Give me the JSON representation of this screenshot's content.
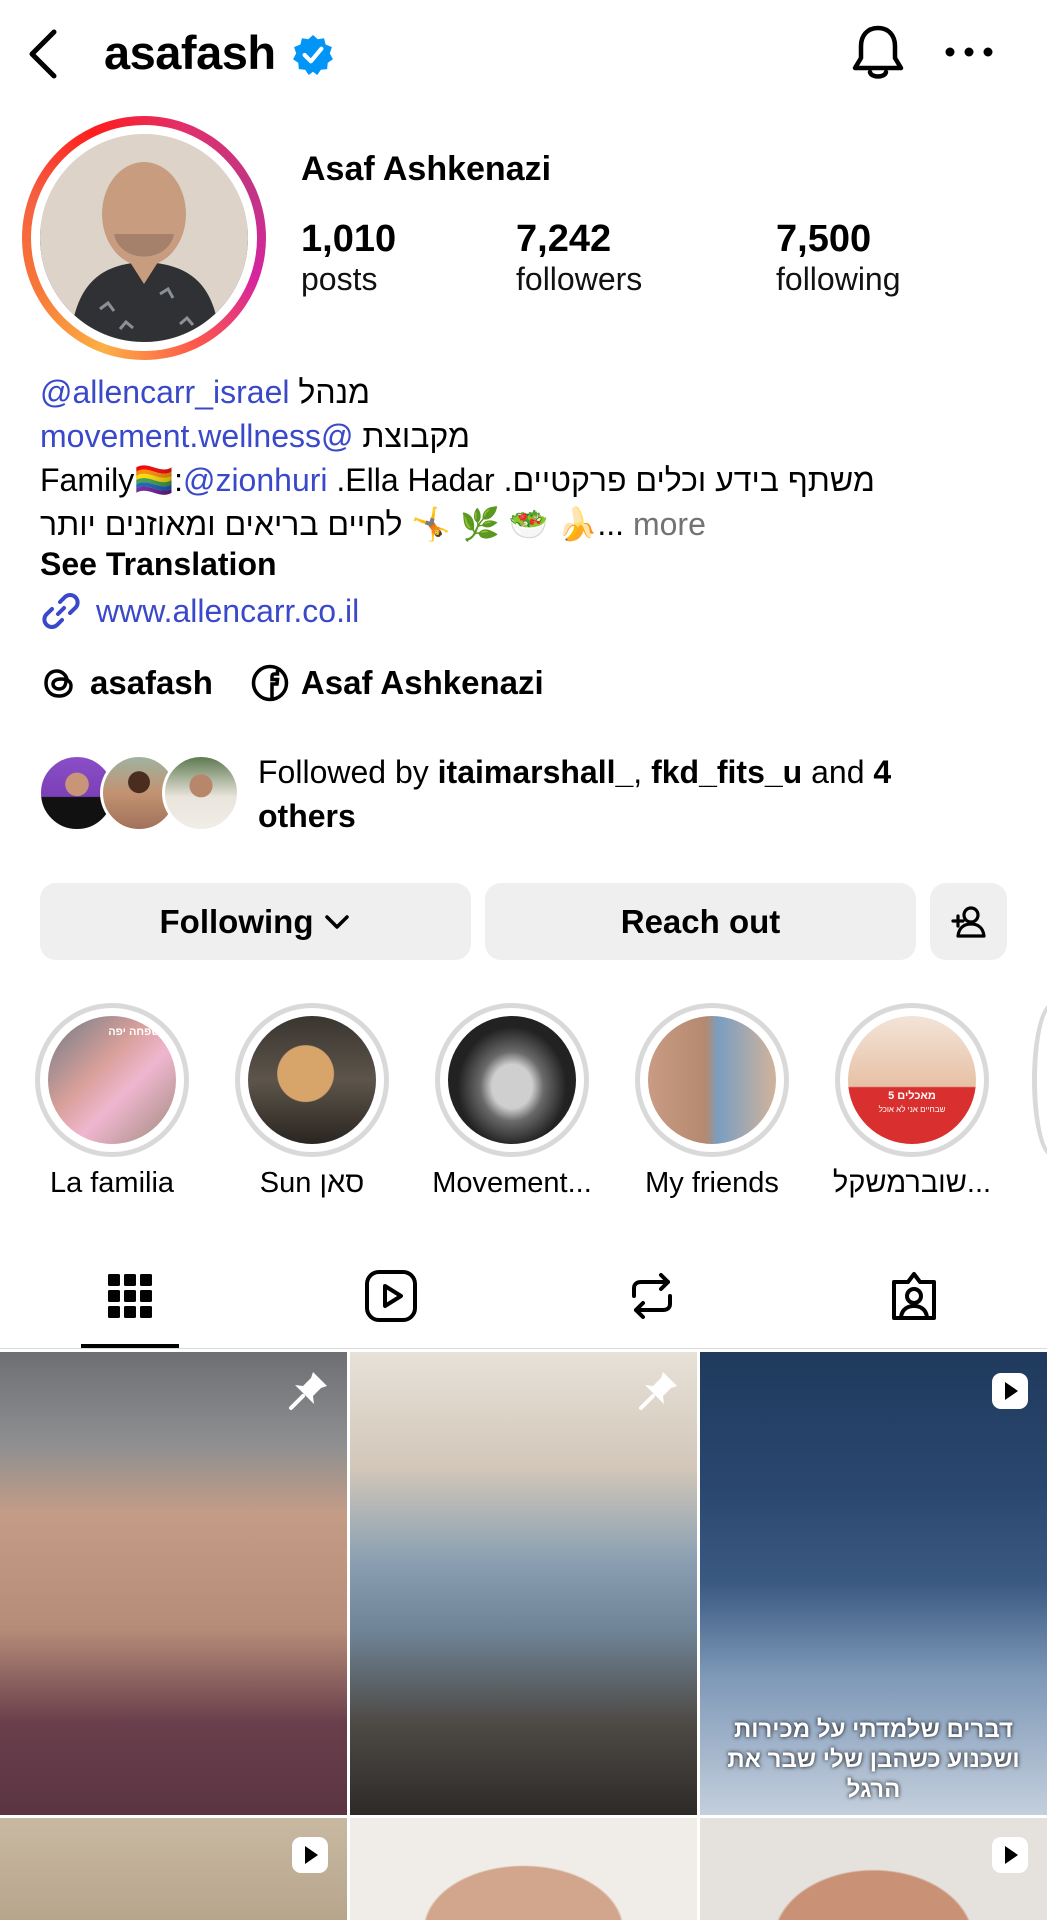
{
  "header": {
    "username": "asafash",
    "back_icon": "chevron-left-icon",
    "verified_icon": "verified-badge-icon",
    "notification_icon": "bell-icon",
    "more_icon": "more-horizontal-icon"
  },
  "profile": {
    "full_name": "Asaf Ashkenazi",
    "stats": [
      {
        "value": "1,010",
        "label": "posts"
      },
      {
        "value": "7,242",
        "label": "followers"
      },
      {
        "value": "7,500",
        "label": "following"
      }
    ]
  },
  "bio": {
    "line1_link": "@allencarr_israel",
    "line1_text": " מנהל",
    "line2_link": "movement.wellness@",
    "line2_text": " מקבוצת",
    "line3_prefix": "Family🏳️‍🌈:",
    "line3_link": "@zionhuri",
    "line3_text": " .Ella Hadar .משתף בידע וכלים פרקטיים",
    "line4_text": "לחיים בריאים ומאוזנים יותר 🤸 🌿 🥗 🍌...",
    "more_label": " more",
    "see_translation": "See Translation",
    "url": "www.allencarr.co.il"
  },
  "social": {
    "threads_handle": "asafash",
    "facebook_name": "Asaf Ashkenazi"
  },
  "followed_by": {
    "prefix": "Followed by ",
    "user1": "itaimarshall_",
    "separator": ", ",
    "user2": "fkd_fits_u",
    "and": " and ",
    "count": "4",
    "suffix": "others"
  },
  "buttons": {
    "following": "Following",
    "reach_out": "Reach out"
  },
  "highlights": [
    {
      "label": "La familia"
    },
    {
      "label": "Sun סאן"
    },
    {
      "label": "Movement..."
    },
    {
      "label": "My friends"
    },
    {
      "label": "שוברמשקל..."
    }
  ],
  "highlight_overlay_text": {
    "h1": "משפחה יפה",
    "h5_top": "5 מאכלים",
    "h5_mid": "שבחיים אני לא אוכל"
  },
  "tabs": [
    "grid-icon",
    "reels-icon",
    "reposts-icon",
    "tagged-icon"
  ],
  "posts": {
    "caption3": "דברים שלמדתי על מכירות ושכנוע כשהבן שלי שבר את הרגל"
  },
  "colors": {
    "link": "#3a49c9",
    "verified": "#0095f6",
    "button_bg": "#efefef"
  }
}
